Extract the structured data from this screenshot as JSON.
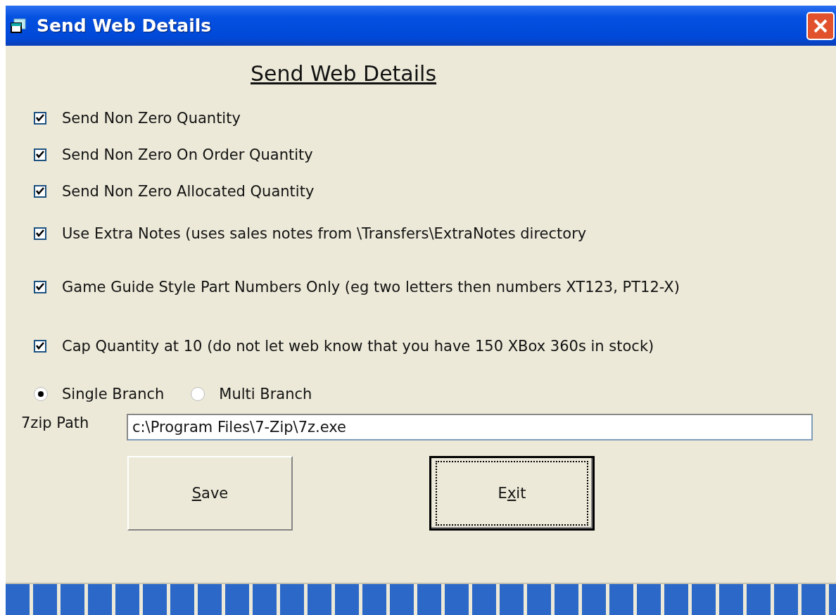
{
  "window": {
    "title": "Send Web Details"
  },
  "heading": "Send Web Details",
  "options": [
    {
      "label": "Send Non Zero Quantity",
      "checked": true
    },
    {
      "label": "Send Non Zero On Order Quantity",
      "checked": true
    },
    {
      "label": "Send Non Zero Allocated Quantity",
      "checked": true
    },
    {
      "label": "Use Extra Notes (uses sales notes from \\Transfers\\ExtraNotes directory",
      "checked": true
    },
    {
      "label": "Game Guide Style Part Numbers Only (eg two letters then numbers XT123, PT12-X)",
      "checked": true
    },
    {
      "label": "Cap Quantity at 10 (do not let web know that you have 150 XBox 360s in stock)",
      "checked": true
    }
  ],
  "branch": [
    {
      "label": "Single Branch",
      "selected": true
    },
    {
      "label": "Multi Branch",
      "selected": false
    }
  ],
  "path_field": {
    "label": "7zip Path",
    "value": "c:\\Program Files\\7-Zip\\7z.exe"
  },
  "buttons": [
    {
      "access_key": "S",
      "label_rest": "ave",
      "focused": false
    },
    {
      "label_start": "E",
      "access_key": "x",
      "label_rest": "it",
      "focused": true
    }
  ],
  "progress": {
    "level": 1
  }
}
